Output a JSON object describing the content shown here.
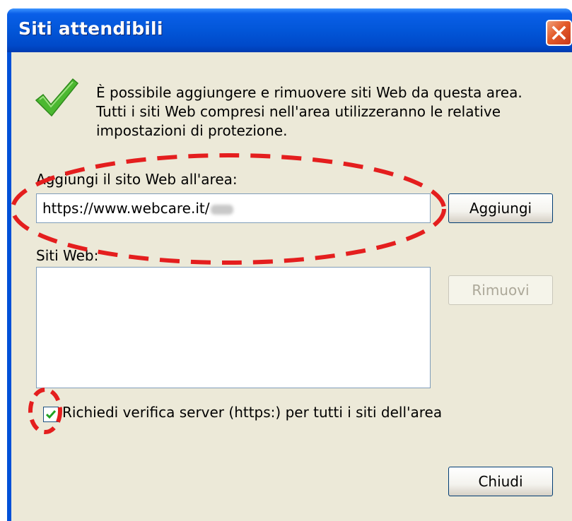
{
  "dialog": {
    "title": "Siti attendibili",
    "info_text": "È possibile aggiungere e rimuovere siti Web da questa area.\nTutti i siti Web compresi nell'area utilizzeranno le relative\nimpostazioni di protezione.",
    "add_label": "Aggiungi il sito Web all'area:",
    "url_value": "https://www.webcare.it/",
    "add_button": "Aggiungi",
    "sites_label": "Siti Web:",
    "remove_button": "Rimuovi",
    "checkbox_label": "Richiedi verifica server (https:) per tutti i siti dell'area",
    "checkbox_checked": true,
    "close_button": "Chiudi"
  },
  "icons": {
    "title_close": "close-icon",
    "check": "green-check-icon",
    "checkbox_mark": "checkmark-icon"
  },
  "colors": {
    "titlebar": "#0256d8",
    "client": "#ece9d8",
    "annotation": "#e41e1e",
    "check": "#4bb830"
  }
}
